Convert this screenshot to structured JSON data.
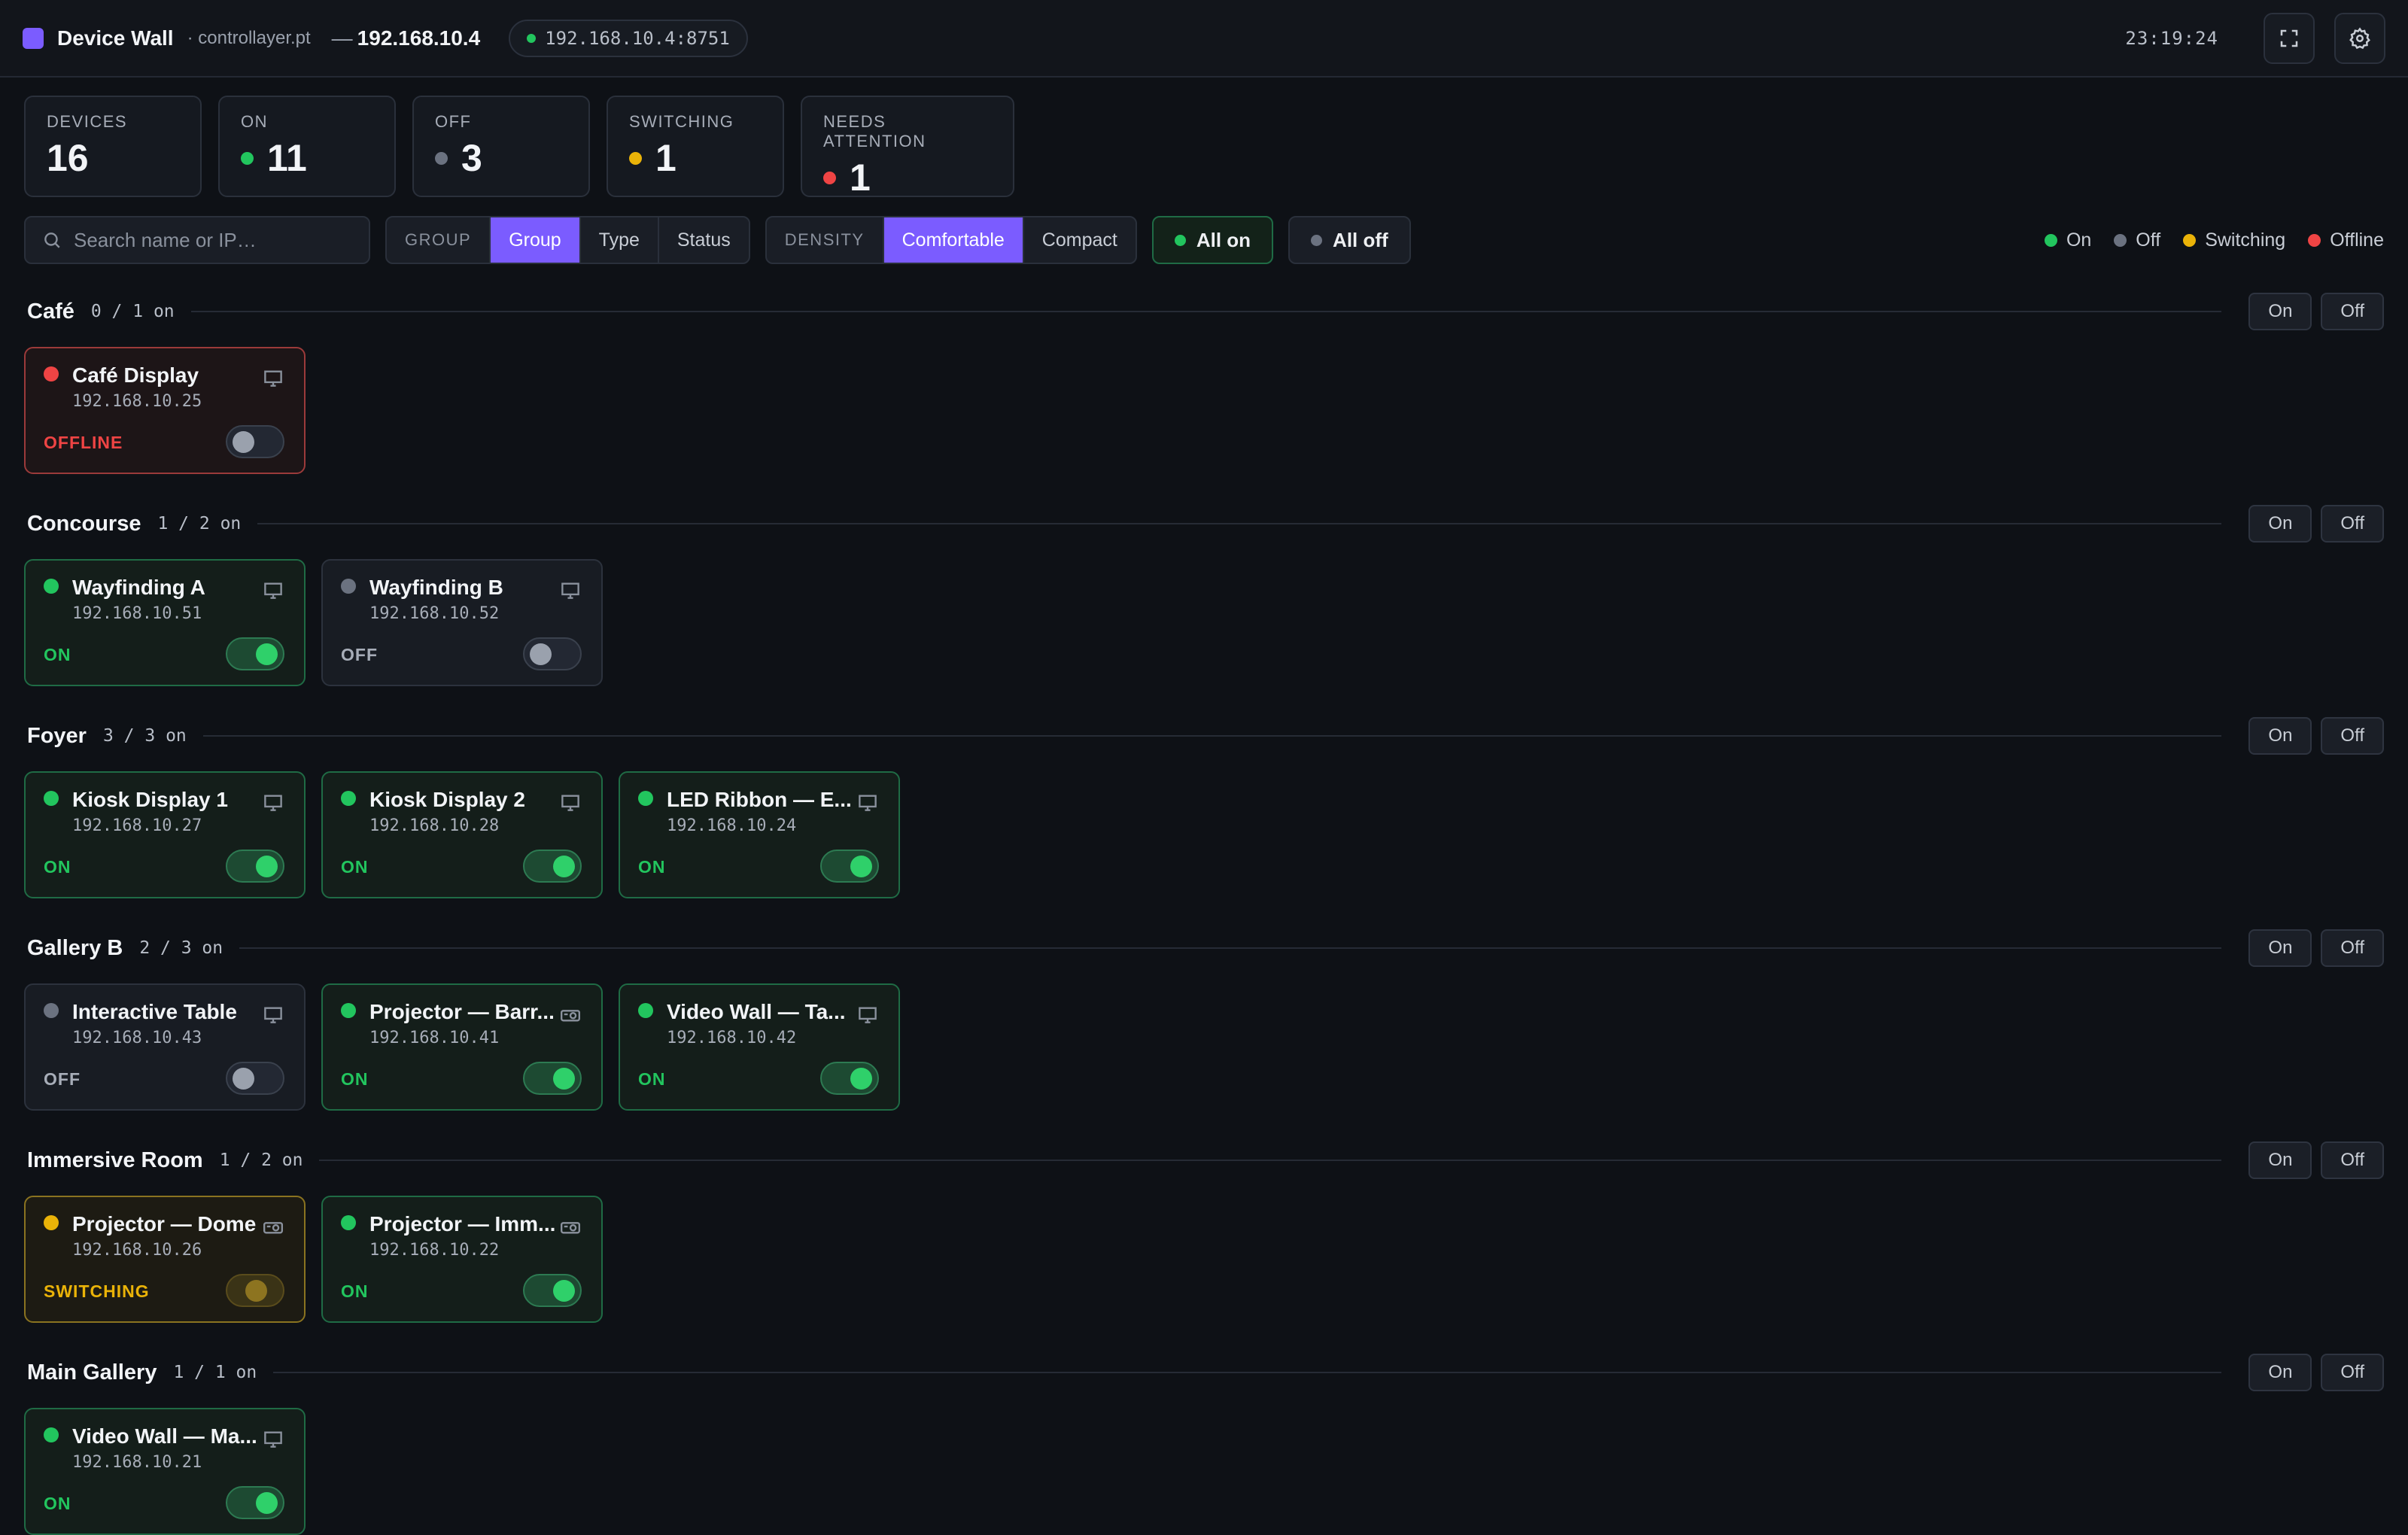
{
  "app": {
    "title": "Device Wall",
    "subtitle": "· controllayer.pt",
    "host_prefix": "—",
    "host": "192.168.10.4",
    "connection": "192.168.10.4:8751",
    "clock": "23:19:24"
  },
  "stats": [
    {
      "label": "DEVICES",
      "value": "16",
      "dot": null
    },
    {
      "label": "ON",
      "value": "11",
      "dot": "#22c55e"
    },
    {
      "label": "OFF",
      "value": "3",
      "dot": "#6b7280"
    },
    {
      "label": "SWITCHING",
      "value": "1",
      "dot": "#eab308"
    },
    {
      "label": "NEEDS ATTENTION",
      "value": "1",
      "dot": "#ef4444"
    }
  ],
  "toolbar": {
    "search_placeholder": "Search name or IP…",
    "group_label": "GROUP",
    "group_options": [
      "Group",
      "Type",
      "Status"
    ],
    "group_selected": "Group",
    "density_label": "DENSITY",
    "density_options": [
      "Comfortable",
      "Compact"
    ],
    "density_selected": "Comfortable",
    "all_on": "All on",
    "all_off": "All off"
  },
  "legend": [
    {
      "label": "On",
      "color": "#22c55e"
    },
    {
      "label": "Off",
      "color": "#6b7280"
    },
    {
      "label": "Switching",
      "color": "#eab308"
    },
    {
      "label": "Offline",
      "color": "#ef4444"
    }
  ],
  "group_buttons": {
    "on": "On",
    "off": "Off"
  },
  "status_colors": {
    "on": "#22c55e",
    "off": "#6b7280",
    "switching": "#eab308",
    "offline": "#ef4444"
  },
  "status_text_colors": {
    "on": "#22c55e",
    "off": "#a7adb8",
    "switching": "#eab308",
    "offline": "#ef4444"
  },
  "groups": [
    {
      "name": "Café",
      "count": "0 / 1 on",
      "devices": [
        {
          "name": "Café Display",
          "ip": "192.168.10.25",
          "status": "offline",
          "status_label": "OFFLINE",
          "type": "display-icon"
        }
      ]
    },
    {
      "name": "Concourse",
      "count": "1 / 2 on",
      "devices": [
        {
          "name": "Wayfinding A",
          "ip": "192.168.10.51",
          "status": "on",
          "status_label": "ON",
          "type": "display-icon"
        },
        {
          "name": "Wayfinding B",
          "ip": "192.168.10.52",
          "status": "off",
          "status_label": "OFF",
          "type": "display-icon"
        }
      ]
    },
    {
      "name": "Foyer",
      "count": "3 / 3 on",
      "devices": [
        {
          "name": "Kiosk Display 1",
          "ip": "192.168.10.27",
          "status": "on",
          "status_label": "ON",
          "type": "display-icon"
        },
        {
          "name": "Kiosk Display 2",
          "ip": "192.168.10.28",
          "status": "on",
          "status_label": "ON",
          "type": "display-icon"
        },
        {
          "name": "LED Ribbon — E...",
          "ip": "192.168.10.24",
          "status": "on",
          "status_label": "ON",
          "type": "display-icon"
        }
      ]
    },
    {
      "name": "Gallery B",
      "count": "2 / 3 on",
      "devices": [
        {
          "name": "Interactive Table",
          "ip": "192.168.10.43",
          "status": "off",
          "status_label": "OFF",
          "type": "display-icon"
        },
        {
          "name": "Projector — Barr...",
          "ip": "192.168.10.41",
          "status": "on",
          "status_label": "ON",
          "type": "projector-icon"
        },
        {
          "name": "Video Wall — Ta...",
          "ip": "192.168.10.42",
          "status": "on",
          "status_label": "ON",
          "type": "display-icon"
        }
      ]
    },
    {
      "name": "Immersive Room",
      "count": "1 / 2 on",
      "devices": [
        {
          "name": "Projector — Dome",
          "ip": "192.168.10.26",
          "status": "switching",
          "status_label": "SWITCHING",
          "type": "projector-icon"
        },
        {
          "name": "Projector — Imm...",
          "ip": "192.168.10.22",
          "status": "on",
          "status_label": "ON",
          "type": "projector-icon"
        }
      ]
    },
    {
      "name": "Main Gallery",
      "count": "1 / 1 on",
      "devices": [
        {
          "name": "Video Wall — Ma...",
          "ip": "192.168.10.21",
          "status": "on",
          "status_label": "ON",
          "type": "display-icon"
        }
      ]
    }
  ]
}
